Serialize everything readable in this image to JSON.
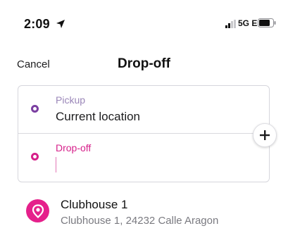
{
  "status_bar": {
    "time": "2:09",
    "network": "5G E",
    "icons": [
      "location-arrow-icon",
      "signal-bars-icon",
      "battery-icon"
    ]
  },
  "header": {
    "cancel_label": "Cancel",
    "title": "Drop-off"
  },
  "location_card": {
    "pickup_label": "Pickup",
    "pickup_value": "Current location",
    "dropoff_label": "Drop-off",
    "dropoff_value": "",
    "add_stop_icon": "plus-icon"
  },
  "suggestions": [
    {
      "name": "Clubhouse 1",
      "address": "Clubhouse 1, 24232 Calle Aragon",
      "icon": "map-pin-icon"
    }
  ],
  "colors": {
    "pickup_accent": "#7b3fa1",
    "dropoff_accent": "#d6208a",
    "place_icon_bg": "#e5208b",
    "card_border": "#d6d6dc"
  }
}
